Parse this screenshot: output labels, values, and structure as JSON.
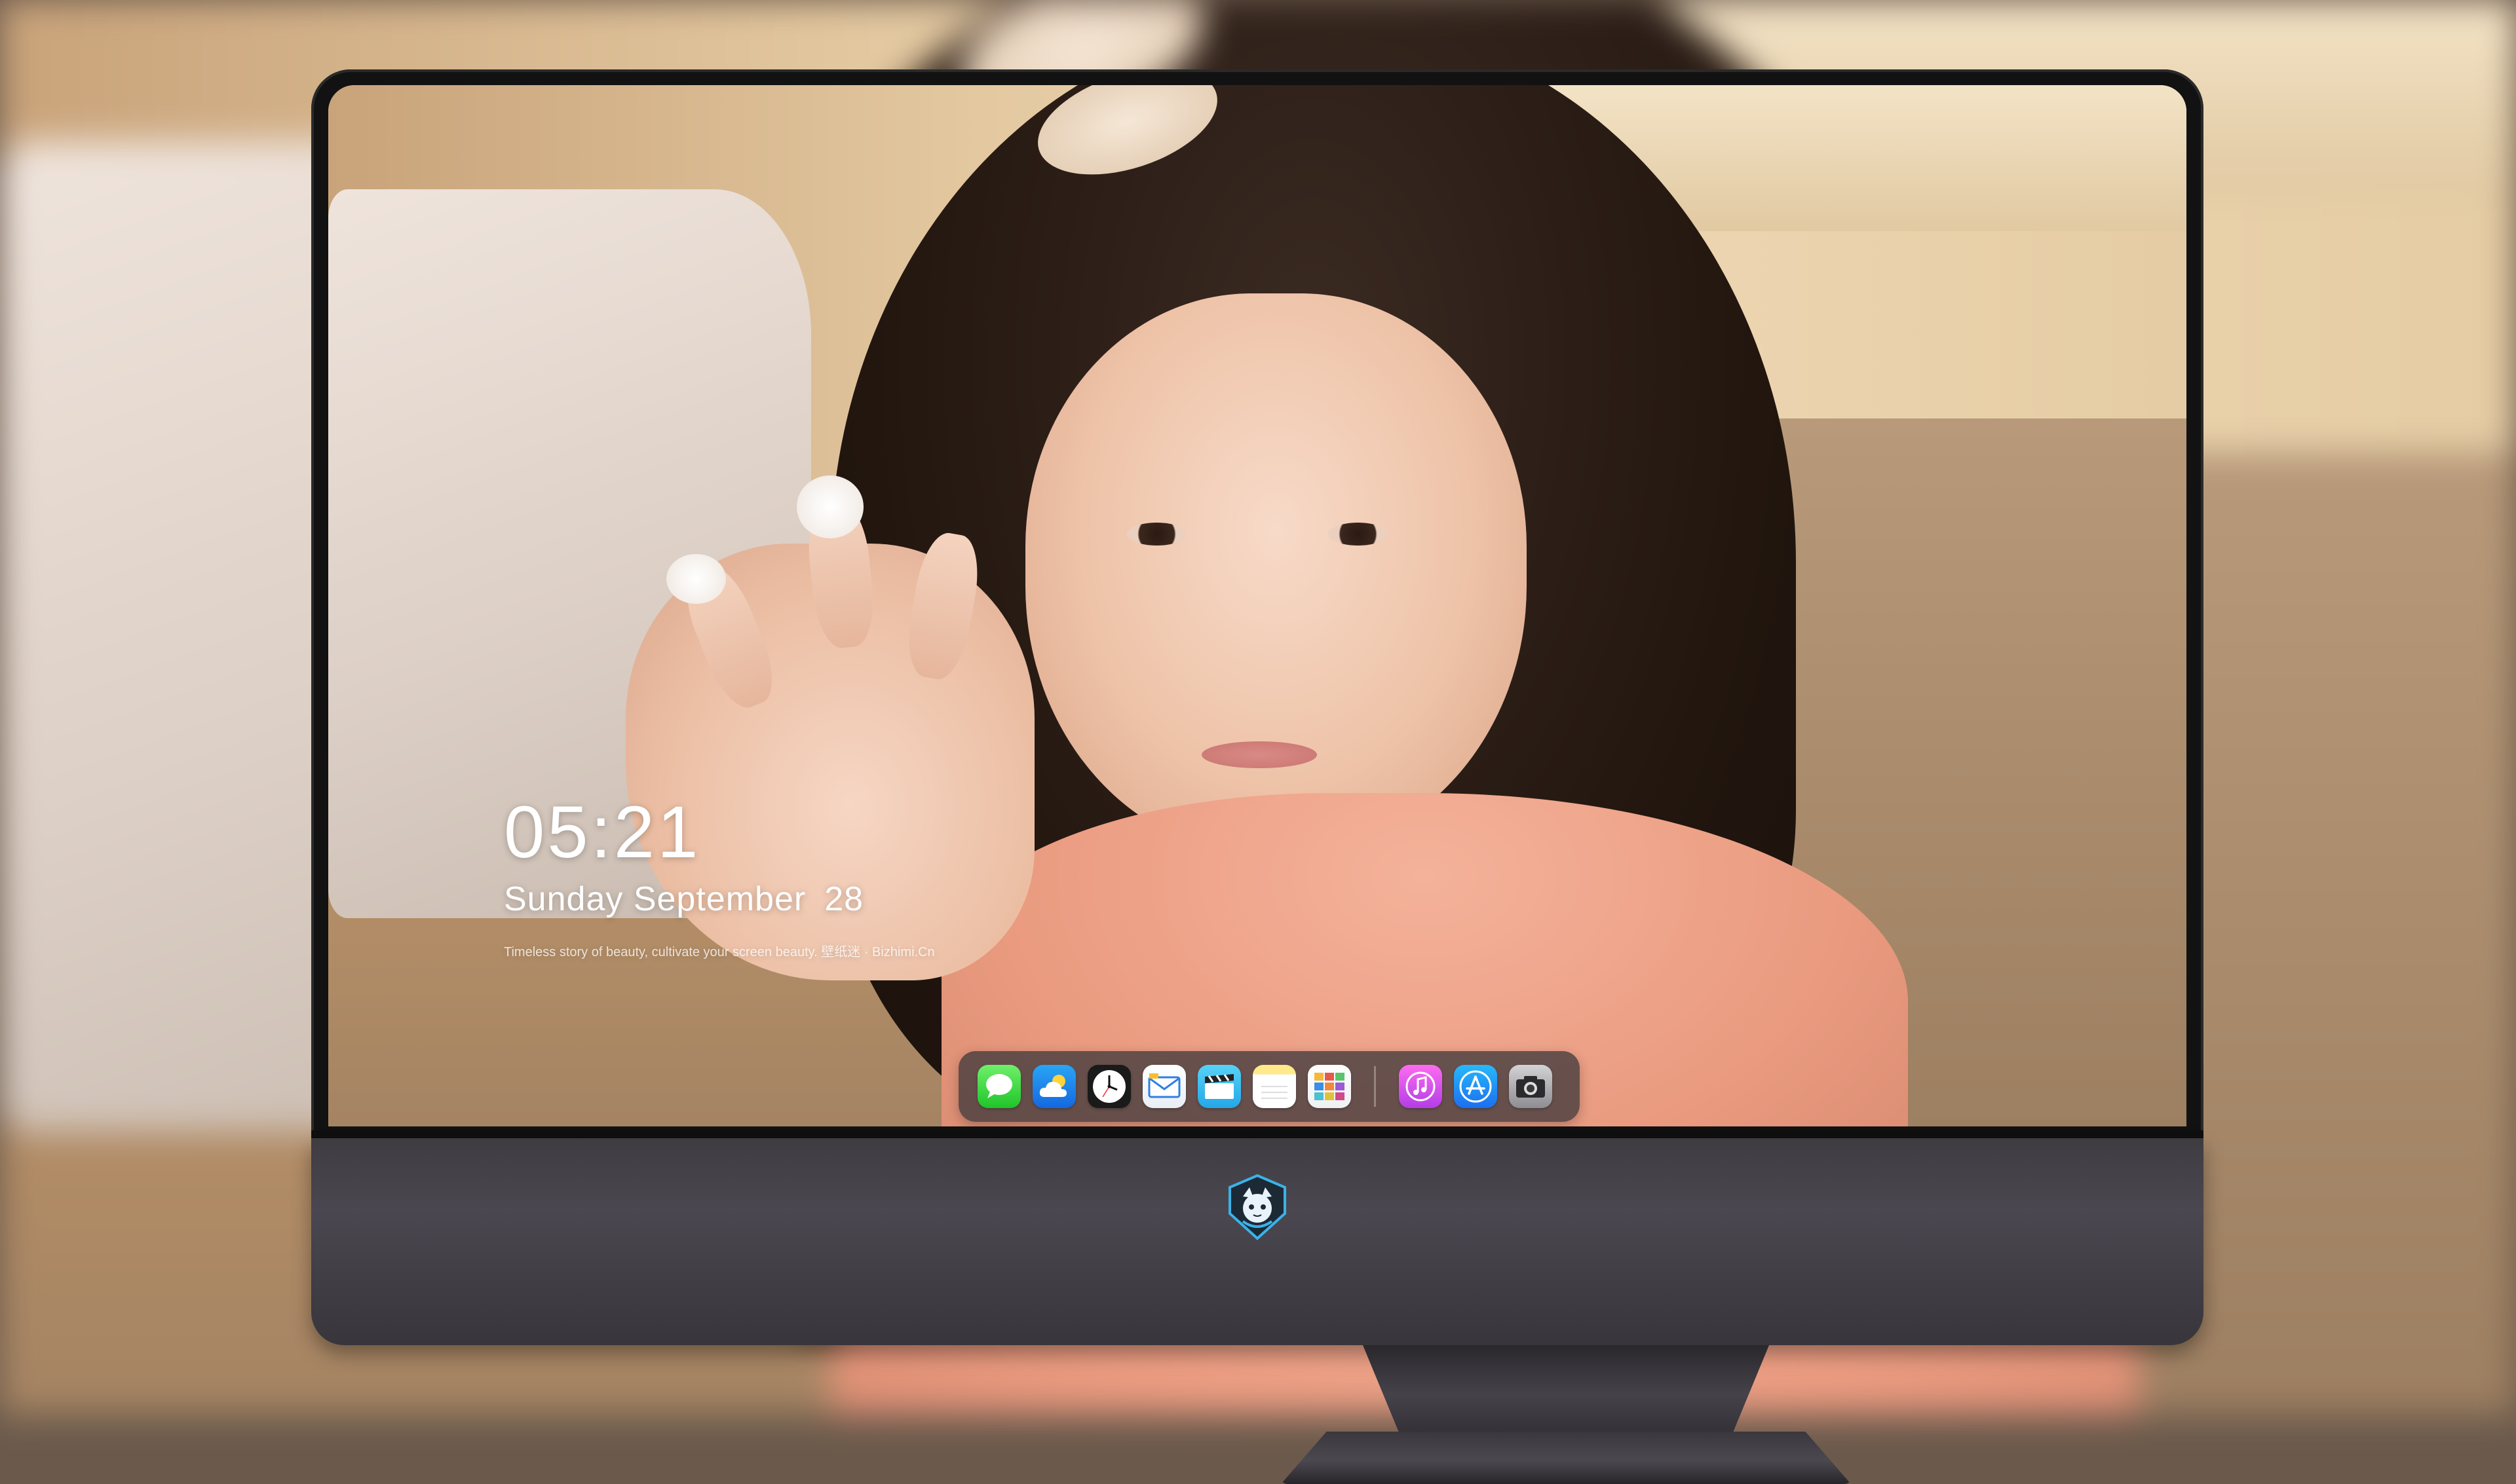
{
  "lock_screen": {
    "time": "05:21",
    "weekday": "Sunday",
    "month": "September",
    "day": "28",
    "tagline": "Timeless story of beauty, cultivate your screen beauty. 壁纸迷 · Bizhimi.Cn"
  },
  "dock": {
    "apps": [
      {
        "name": "Messages",
        "icon": "speech-bubble-icon"
      },
      {
        "name": "Weather",
        "icon": "cloud-sun-icon"
      },
      {
        "name": "Clock",
        "icon": "clock-icon"
      },
      {
        "name": "Mail",
        "icon": "envelope-icon"
      },
      {
        "name": "Videos",
        "icon": "clapperboard-icon"
      },
      {
        "name": "Notes",
        "icon": "notepad-icon"
      },
      {
        "name": "Photos",
        "icon": "photo-grid-icon"
      },
      {
        "name": "Music",
        "icon": "music-note-icon"
      },
      {
        "name": "App Store",
        "icon": "app-store-icon"
      },
      {
        "name": "Camera",
        "icon": "camera-icon"
      }
    ]
  },
  "colors": {
    "bezel": "#121212",
    "chin": "#45424a",
    "dock": "#413a3c",
    "logo_accent": "#3bb2e8"
  }
}
